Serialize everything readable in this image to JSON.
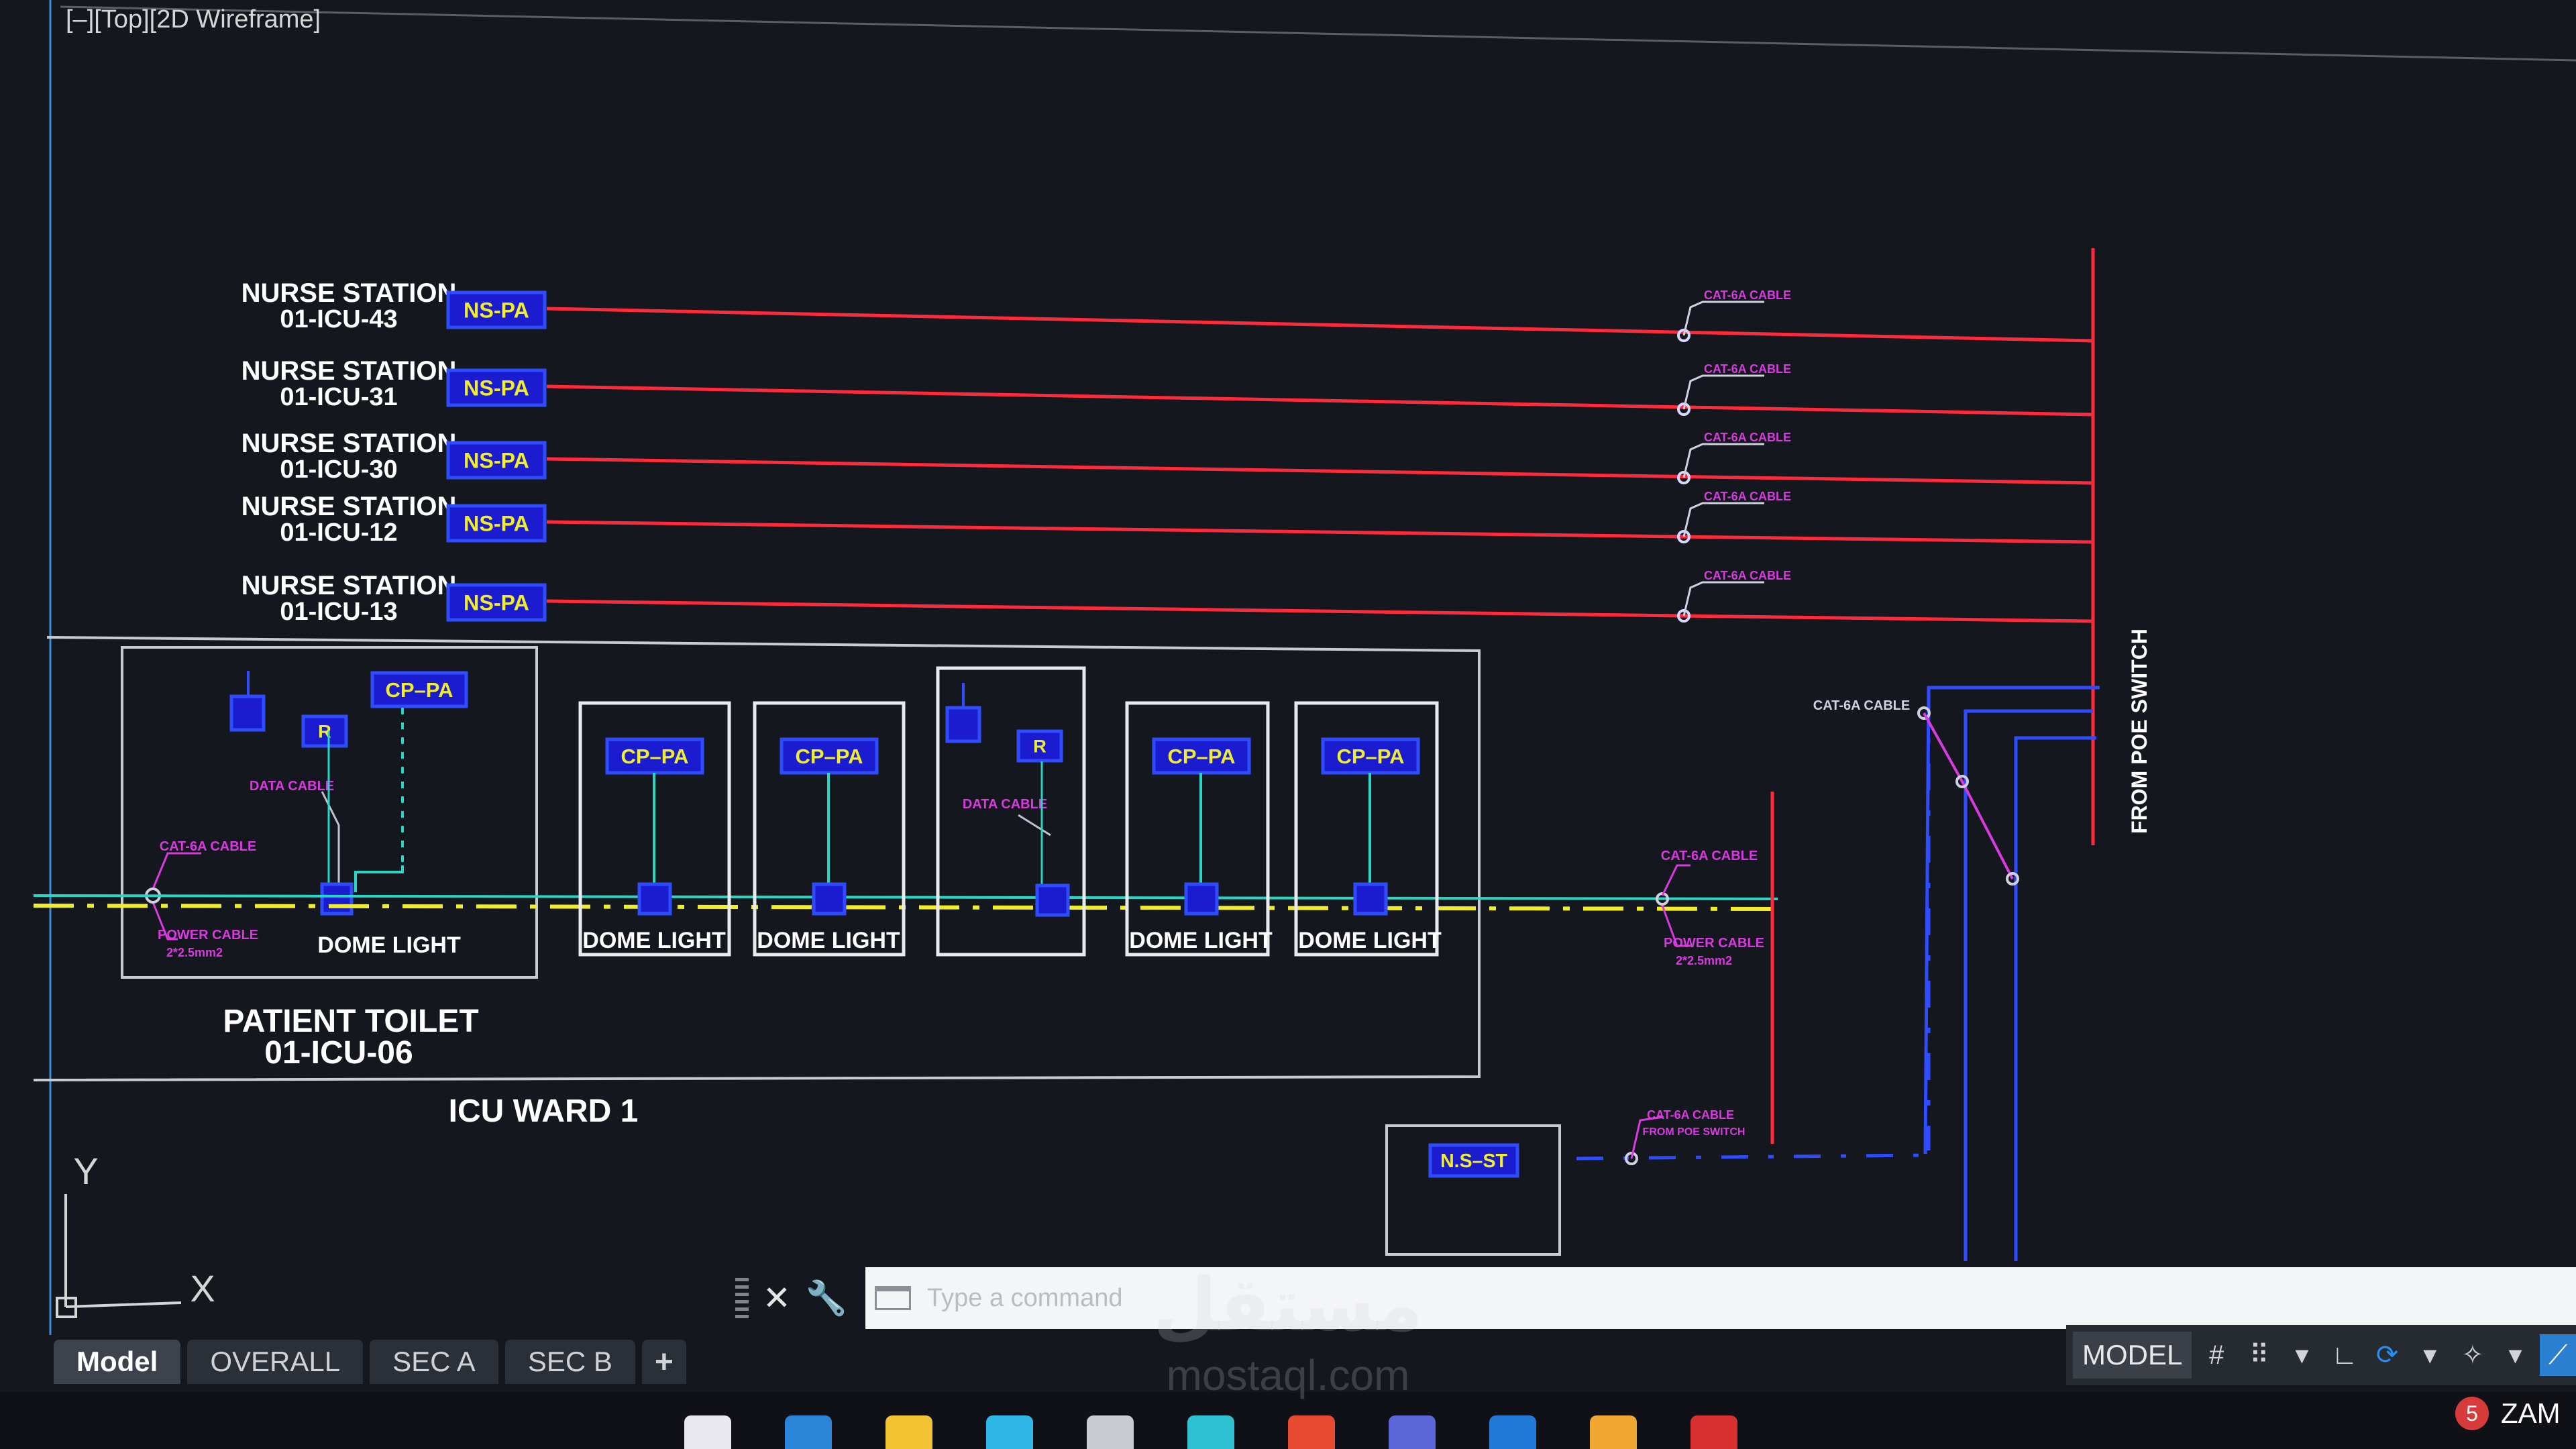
{
  "viewport": {
    "label": "[–][Top][2D Wireframe]"
  },
  "drawing": {
    "nurse_stations": [
      {
        "label": "NURSE STATION",
        "id": "01-ICU-43",
        "tag": "NS-PA",
        "cable": "CAT-6A CABLE"
      },
      {
        "label": "NURSE STATION",
        "id": "01-ICU-31",
        "tag": "NS-PA",
        "cable": "CAT-6A CABLE"
      },
      {
        "label": "NURSE STATION",
        "id": "01-ICU-30",
        "tag": "NS-PA",
        "cable": "CAT-6A CABLE"
      },
      {
        "label": "NURSE STATION",
        "id": "01-ICU-12",
        "tag": "NS-PA",
        "cable": "CAT-6A CABLE"
      },
      {
        "label": "NURSE STATION",
        "id": "01-ICU-13",
        "tag": "NS-PA",
        "cable": "CAT-6A CABLE"
      }
    ],
    "from_poe": "FROM POE SWITCH",
    "toilet": {
      "cp_tag": "CP–PA",
      "r_tag": "R",
      "data_cable": "DATA CABLE",
      "cat6a": "CAT-6A CABLE",
      "power_cable": "POWER CABLE",
      "power_spec": "2*2.5mm2",
      "dome": "DOME LIGHT",
      "title": "PATIENT TOILET",
      "id": "01-ICU-06"
    },
    "beds": [
      {
        "type": "cp",
        "tag": "CP–PA",
        "dome": "DOME LIGHT"
      },
      {
        "type": "cp",
        "tag": "CP–PA",
        "dome": "DOME LIGHT"
      },
      {
        "type": "r",
        "tag": "R",
        "cable": "DATA CABLE"
      },
      {
        "type": "cp",
        "tag": "CP–PA",
        "dome": "DOME LIGHT"
      },
      {
        "type": "cp",
        "tag": "CP–PA",
        "dome": "DOME LIGHT"
      }
    ],
    "ward_label": "ICU WARD 1",
    "right_cat6a": "CAT-6A CABLE",
    "right_power": "POWER CABLE",
    "right_power_spec": "2*2.5mm2",
    "diag_cable": "CAT-6A CABLE",
    "ns_st": {
      "tag": "N.S–ST",
      "cable1": "CAT-6A CABLE",
      "cable2": "FROM POE SWITCH"
    },
    "ucs": {
      "y": "Y",
      "x": "X"
    }
  },
  "command_line": {
    "placeholder": "Type a command"
  },
  "layout_tabs": [
    "Model",
    "OVERALL",
    "SEC A",
    "SEC B"
  ],
  "status_bar": {
    "model": "MODEL"
  },
  "taskbar": {
    "user": "ZAM",
    "badge": "5"
  },
  "watermark": {
    "arabic": "مستقل",
    "latin": "mostaql.com"
  },
  "colors": {
    "red": "#ff2a3c",
    "blue": "#2f4dff",
    "yellow": "#f0ee2a",
    "cyan": "#28d6c4",
    "magenta": "#d93ae0",
    "bg": "#14171e"
  },
  "icons": [
    "close-icon",
    "wrench-icon",
    "grid-icon",
    "snap-icon",
    "ortho-icon",
    "polar-icon",
    "osnap-icon",
    "annotation-icon"
  ]
}
